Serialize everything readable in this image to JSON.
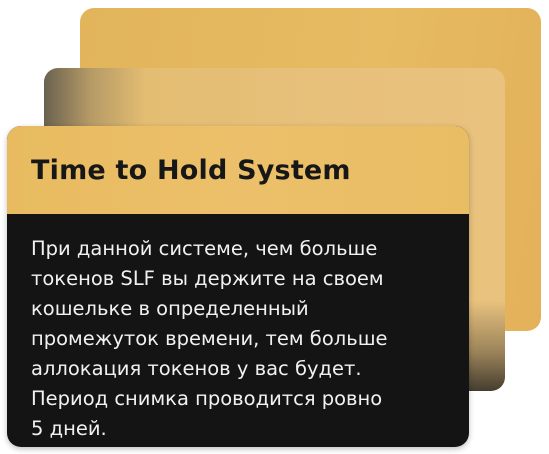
{
  "card": {
    "title": "Time to Hold System",
    "lines": [
      "При данной системе, чем больше",
      "токенов SLF вы держите на своем",
      "кошельке в определенный",
      "промежуток времени, тем больше",
      "аллокация токенов у вас будет.",
      "Период снимка проводится ровно",
      "5 дней."
    ]
  },
  "colors": {
    "gold": "#e8bb60",
    "dark": "#141414",
    "title_text": "#171717",
    "body_text": "#f1f1f1"
  }
}
